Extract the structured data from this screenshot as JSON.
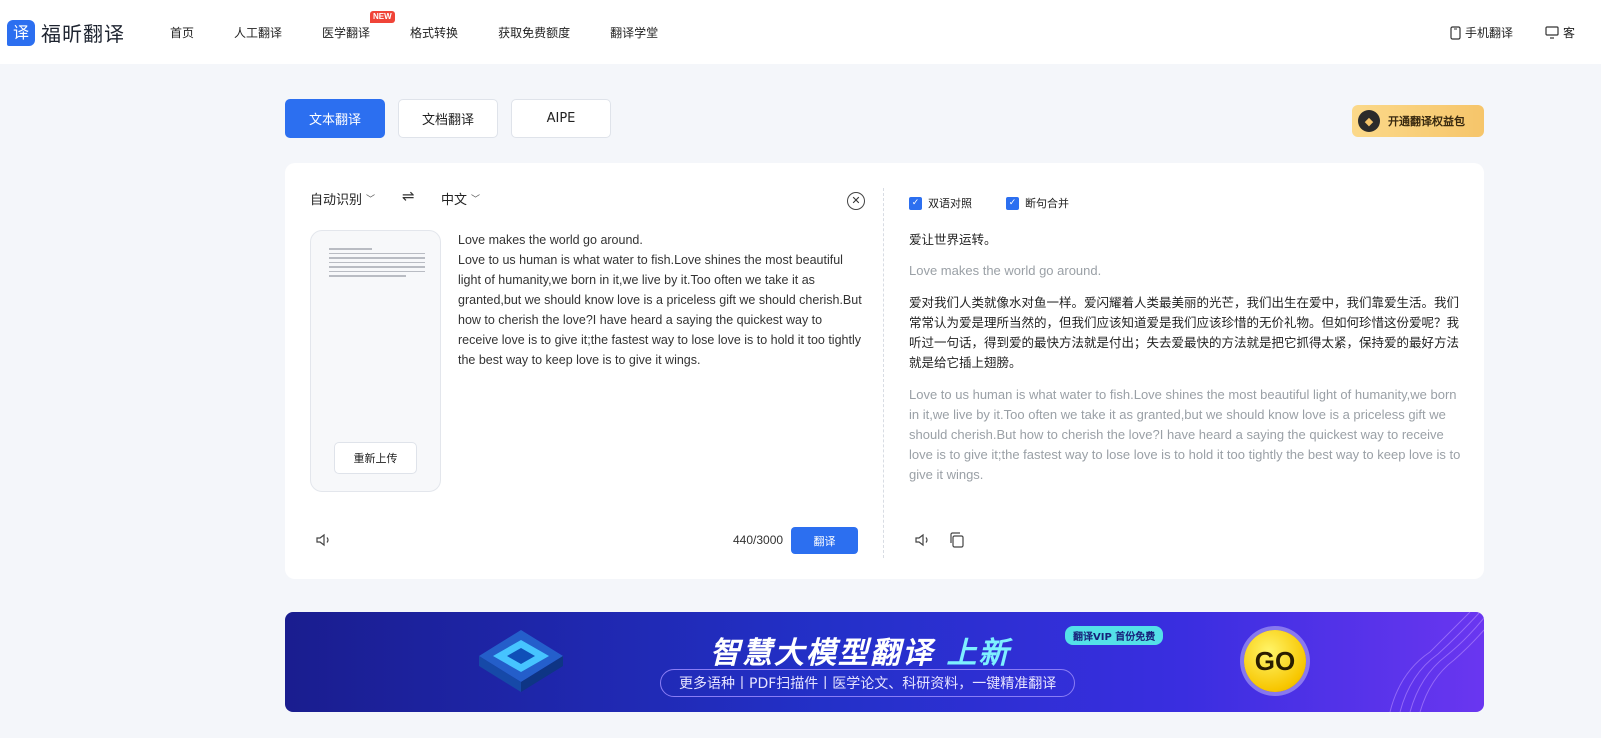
{
  "brand": {
    "logo_char": "译",
    "name": "福昕翻译"
  },
  "nav": {
    "items": [
      {
        "label": "首页"
      },
      {
        "label": "人工翻译"
      },
      {
        "label": "医学翻译",
        "badge": "NEW"
      },
      {
        "label": "格式转换"
      },
      {
        "label": "获取免费额度"
      },
      {
        "label": "翻译学堂"
      }
    ],
    "mobile": "手机翻译",
    "client": "客"
  },
  "tabs": {
    "text": "文本翻译",
    "doc": "文档翻译",
    "aipe": "AIPE"
  },
  "vip": {
    "label": "开通翻译权益包"
  },
  "source": {
    "lang": "自动识别",
    "swap_icon": "⇌",
    "reupload": "重新上传",
    "lines": [
      "Love makes the world go around.",
      "Love to us human is what water to fish.Love shines the most beautiful light of humanity,we born in it,we live by it.Too often we take it as granted,but we should know love is a priceless gift we should cherish.But how to cherish the love?I have heard a saying the quickest way to receive love is to give it;the fastest way to lose love is to hold it too tightly the best way to keep love is to give it wings."
    ],
    "counter": "440/3000",
    "translate": "翻译"
  },
  "target": {
    "lang": "中文",
    "options": {
      "bilingual": "双语对照",
      "merge": "断句合并"
    },
    "zh1": "爱让世界运转。",
    "en1": "Love makes the world go around.",
    "zh2": "爱对我们人类就像水对鱼一样。爱闪耀着人类最美丽的光芒，我们出生在爱中，我们靠爱生活。我们常常认为爱是理所当然的，但我们应该知道爱是我们应该珍惜的无价礼物。但如何珍惜这份爱呢？我听过一句话，得到爱的最快方法就是付出；失去爱最快的方法就是把它抓得太紧，保持爱的最好方法就是给它插上翅膀。",
    "en2": "Love to us human is what water to fish.Love shines the most beautiful light of humanity,we born in it,we live by it.Too often we take it as granted,but we should know love is a priceless gift we should cherish.But how to cherish the love?I have heard a saying the quickest way to receive love is to give it;the fastest way to lose love is to hold it too tightly the best way to keep love is to give it wings."
  },
  "banner": {
    "title_main": "智慧大模型翻译 ",
    "title_hl": "上新",
    "tag": "翻译VIP 首份免费",
    "subtitle": "更多语种丨PDF扫描件丨医学论文、科研资料，一键精准翻译",
    "go": "GO"
  },
  "colors": {
    "primary": "#2c6ff0",
    "badge": "#f04438",
    "vip": "#f6c56a"
  }
}
